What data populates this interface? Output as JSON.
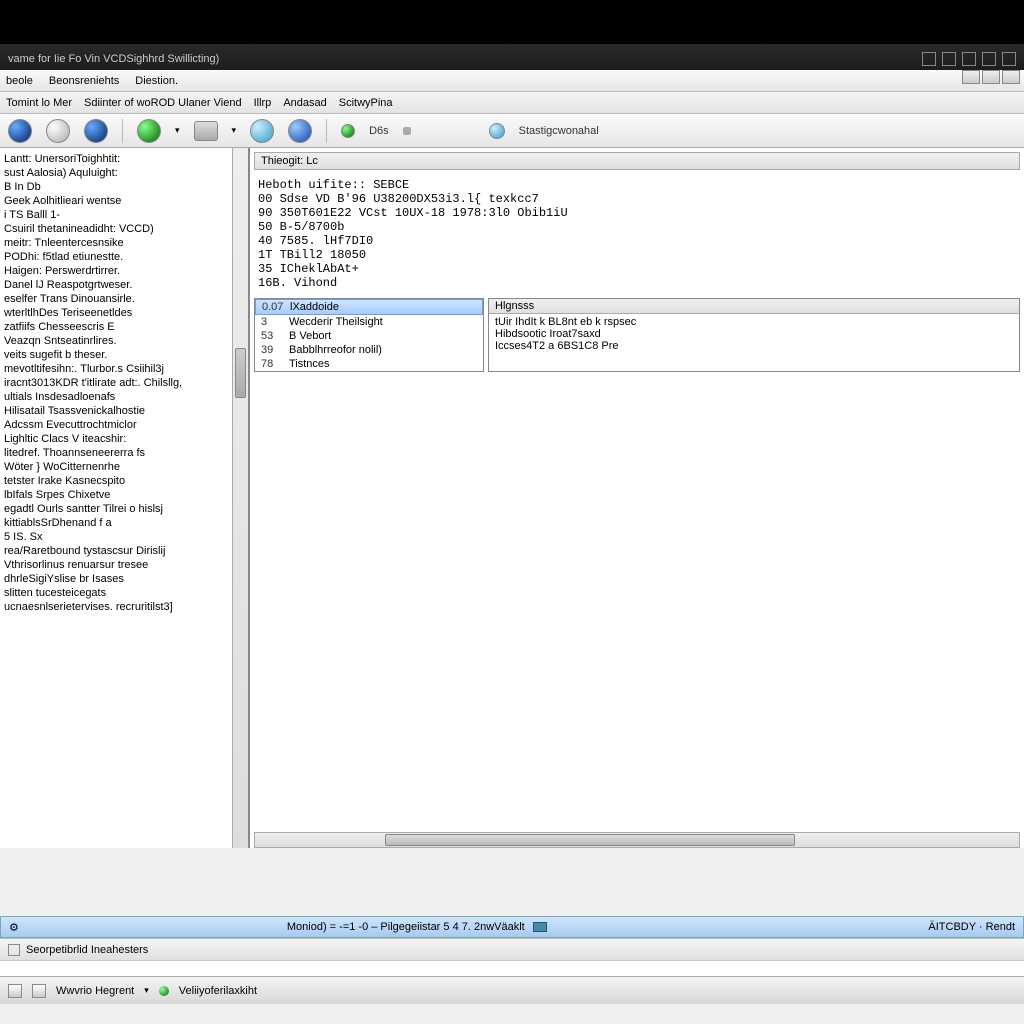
{
  "title": "vame for Iie Fo Vin VCDSighhrd Swillicting)",
  "menu": {
    "m1": "beole",
    "m2": "Beonsreniehts",
    "m3": "Diestion."
  },
  "tabs": {
    "t1": "Tomint lo Mer",
    "t2": "Sdiinter of woROD Ulaner Viend",
    "t3": "Illrp",
    "t4": "Andasad",
    "t5": "ScitwyPina"
  },
  "toolbar": {
    "d3": "D6s",
    "stat": "Stastigcwonahal"
  },
  "left": {
    "items": [
      "Lantt:  UnersoriToighhtit:",
      "sust  Aalosia)  Aquluight:",
      "B In    Db",
      "Geek   Aolhitlieari  wentse",
      "i TS  Balll 1-",
      "Csuiril  thetanineadidht:  VCCD)",
      "meitr:  Tnleentercesnsike",
      "PODhi: f5tlad etiunestte.",
      "Haigen:  Perswerdrtirrer.",
      "Danel  lJ  Reaspotgrtweser.",
      "eselfer  Trans   Dinouansirle.",
      "wterltlhDes  Teriseenetldes",
      "zatfiifs  Chesseescris E",
      "Veazqn  Sntseatinrlires.",
      "veits sugefit b  theser.",
      "mevotltifesihn:.    Tlurbor.s   Csiihil3j",
      "iracnt3013KDR  t'itlirate adt:.   Chilsllg,",
      "ultials   Insdesadloenafs",
      "Hilisatail  Tsassvenickalhostie",
      "Adcssm  Evecuttrochtmiclor",
      "Lighltic  Clacs   V iteacshir:",
      "litedref.  Thoannseneererra fs",
      "Wöter   }   WoCitternenrhe",
      "tetster  Irake  Kasnecspito",
      "lbIfals  Srpes    Chixetve",
      "egadtl  Ourls  santter  Tilrei o hislsj",
      "kittiablsSrDhenand f a",
      "5  IS.  Sx",
      "rea/Raretbound tystascsur   Dirislij",
      "Vthrisorlinus renuarsur tresee",
      "dhrleSigiYslise br  Isases",
      "slitten   tucesteicegats",
      "ucnaesnlserietervises.  recruritilst3]"
    ]
  },
  "diag": {
    "header": "Thieogit: Lc",
    "lines": [
      "Heboth  uifite:: SEBCE",
      "00    Sdse   VD B'96 U38200DX53i3.l{ texkcc7",
      "90    350T601E22  VCst  10UX-18 1978:3l0  Obib1iU",
      "50    B-5/8700b",
      "40    7585. lHf7DI0",
      "1T    TBill2 18050",
      "35    ICheklAbAt+",
      "16B.    Vihond"
    ]
  },
  "modules": {
    "items": [
      {
        "code": "0.07",
        "label": "lXaddoide",
        "sel": true
      },
      {
        "code": "3",
        "label": "Wecderir Theilsight"
      },
      {
        "code": "53",
        "label": "B Vebort"
      },
      {
        "code": "39",
        "label": "Babblhrreofor nolil)"
      },
      {
        "code": "78",
        "label": "Tistnces"
      }
    ]
  },
  "faults": {
    "header": "Hlgnsss",
    "lines": [
      "tUir IhdIt k  BL8nt  eb k   rspsec",
      "Hibdsootic  Iroat7saxd",
      "Iccses4T2  a  6BS1C8  Pre"
    ]
  },
  "status": {
    "left": "Moniod) =  -=1 -0 – Pilgegeiistar  5  4 7.  2nwVäaklt",
    "right": "ÄITCBDY · Rendt",
    "s2": "Seorpetibrlid  Ineahesters",
    "gear": "⚙"
  },
  "taskbar": {
    "t1": "Wwvrio Hegrent",
    "t2": "Veliiyoferilaxkiht"
  }
}
